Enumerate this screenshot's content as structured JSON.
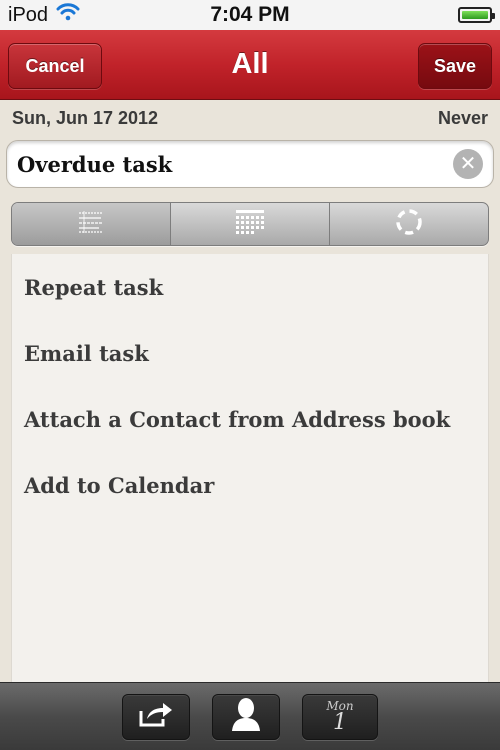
{
  "status_bar": {
    "device": "iPod",
    "time": "7:04 PM"
  },
  "nav": {
    "title": "All",
    "cancel_label": "Cancel",
    "save_label": "Save"
  },
  "date_row": {
    "date": "Sun, Jun 17 2012",
    "repeat": "Never"
  },
  "task": {
    "value": "Overdue task"
  },
  "segments": [
    {
      "icon": "notes-lines-icon"
    },
    {
      "icon": "calendar-grid-icon"
    },
    {
      "icon": "dashed-circle-icon"
    }
  ],
  "actions": [
    {
      "label": "Repeat task"
    },
    {
      "label": "Email task"
    },
    {
      "label": "Attach a Contact from Address book"
    },
    {
      "label": "Add to Calendar"
    }
  ],
  "toolbar": {
    "share_icon": "share-icon",
    "contact_icon": "person-icon",
    "calendar": {
      "day": "Mon",
      "date": "1"
    }
  },
  "colors": {
    "nav_red": "#c1232a",
    "background": "#e9e4da",
    "toolbar": "#4a4a4a"
  }
}
